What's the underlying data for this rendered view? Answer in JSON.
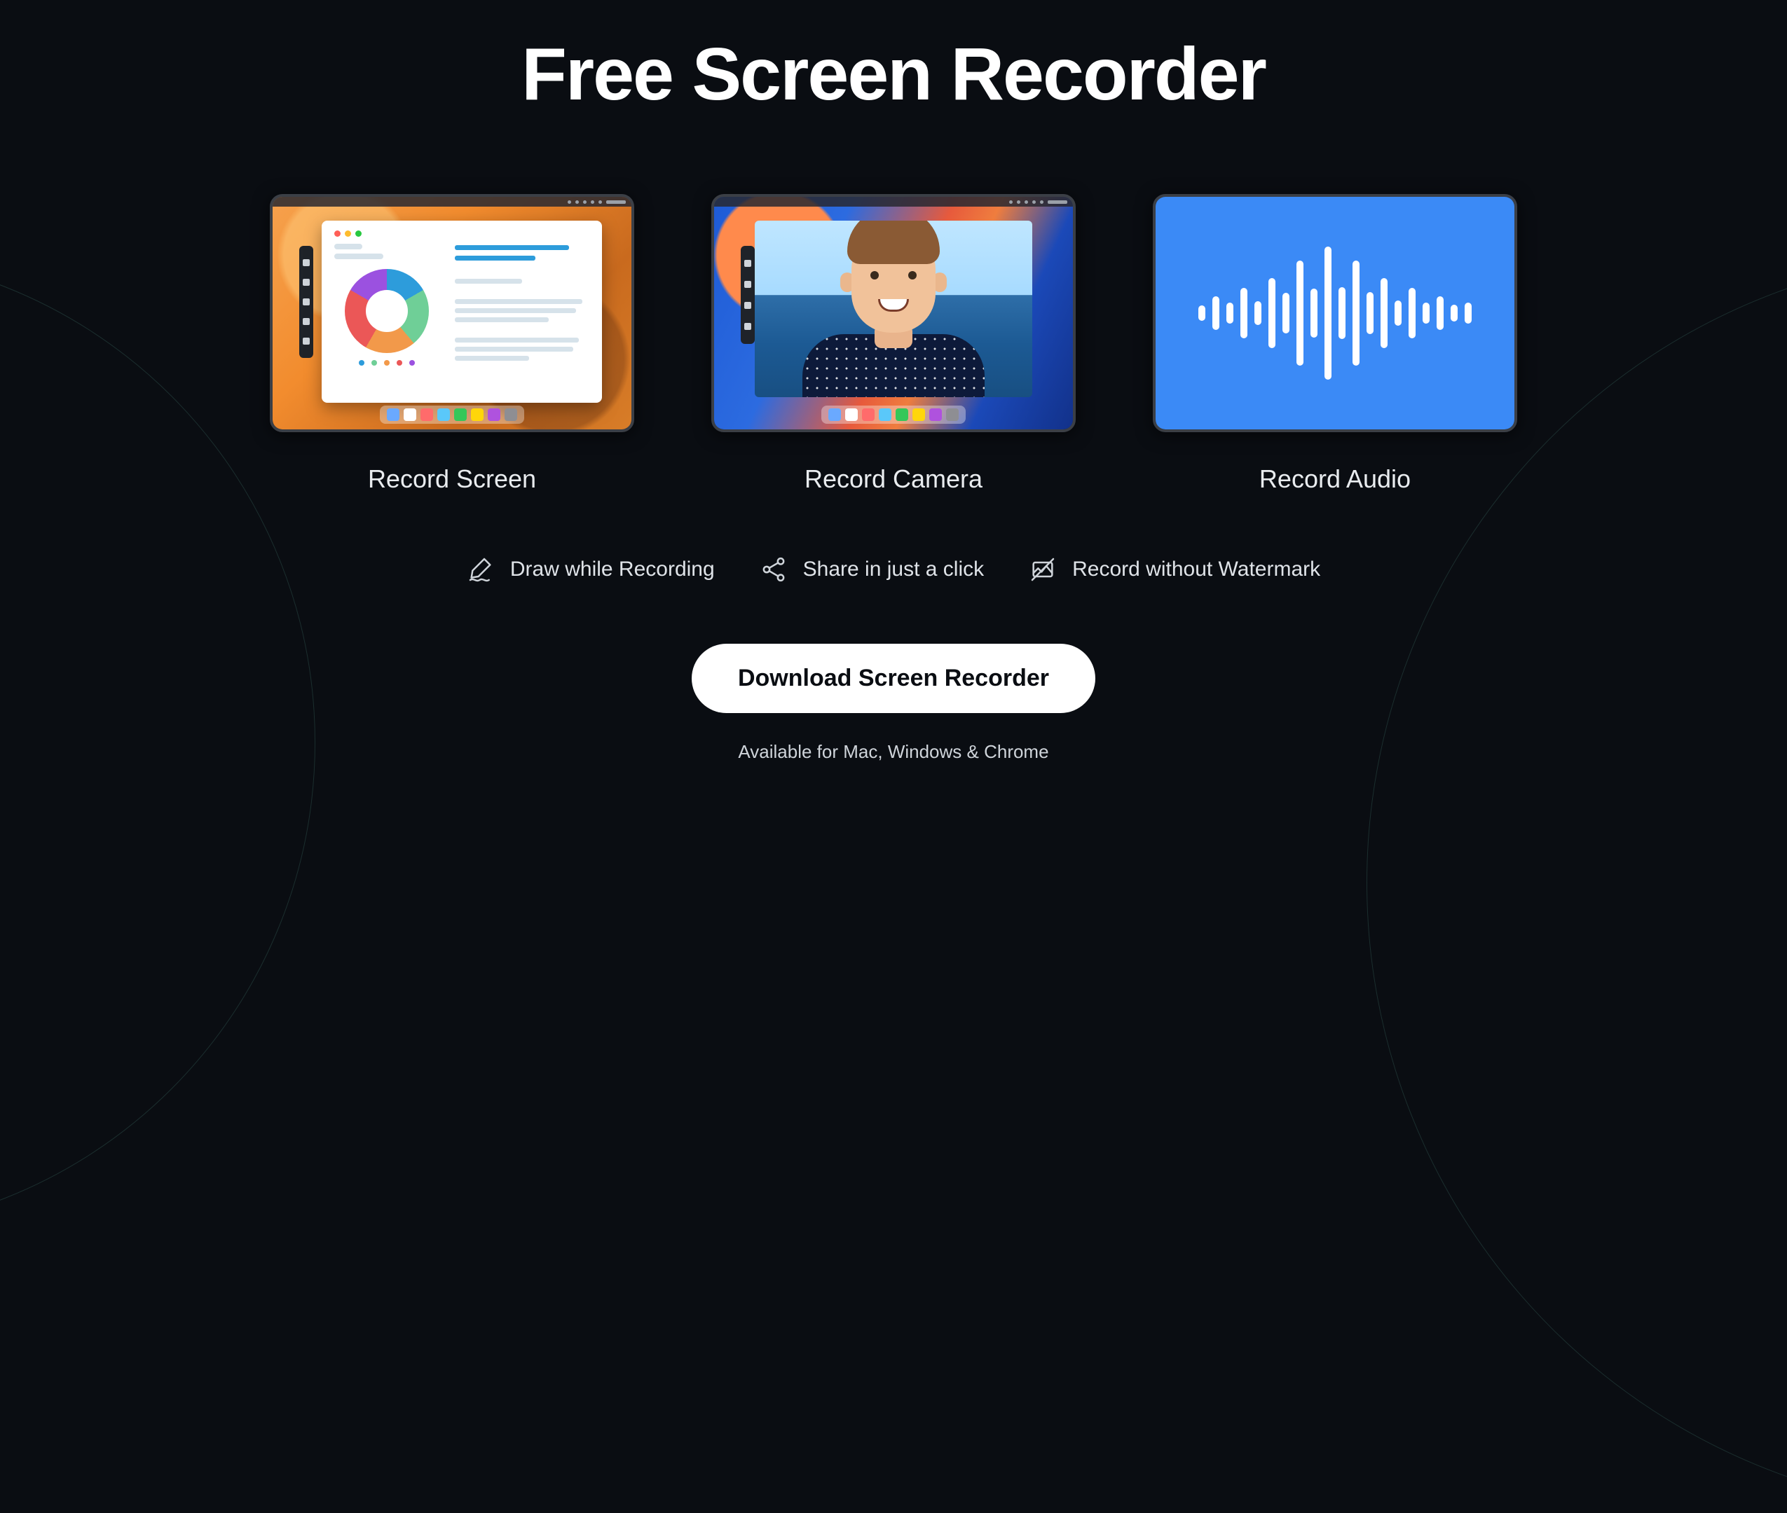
{
  "hero": {
    "title": "Free Screen Recorder"
  },
  "cards": {
    "screen": {
      "label": "Record Screen",
      "icon": "desktop-donut-illustration"
    },
    "camera": {
      "label": "Record Camera",
      "icon": "webcam-person-illustration"
    },
    "audio": {
      "label": "Record Audio",
      "icon": "waveform-illustration"
    }
  },
  "features": {
    "draw": {
      "label": "Draw while Recording",
      "icon": "pen-draw-icon"
    },
    "share": {
      "label": "Share in just a click",
      "icon": "share-nodes-icon"
    },
    "nowm": {
      "label": "Record without Watermark",
      "icon": "no-watermark-icon"
    }
  },
  "cta": {
    "label": "Download Screen Recorder"
  },
  "availability": "Available for Mac, Windows & Chrome",
  "audio_bars": [
    22,
    48,
    30,
    72,
    34,
    100,
    58,
    150,
    70,
    190,
    74,
    150,
    60,
    100,
    36,
    72,
    30,
    48,
    24,
    30
  ],
  "colors": {
    "bg": "#0a0d12",
    "accent_audio": "#3b8af6",
    "cta_bg": "#ffffff",
    "cta_text": "#0a0d12"
  }
}
